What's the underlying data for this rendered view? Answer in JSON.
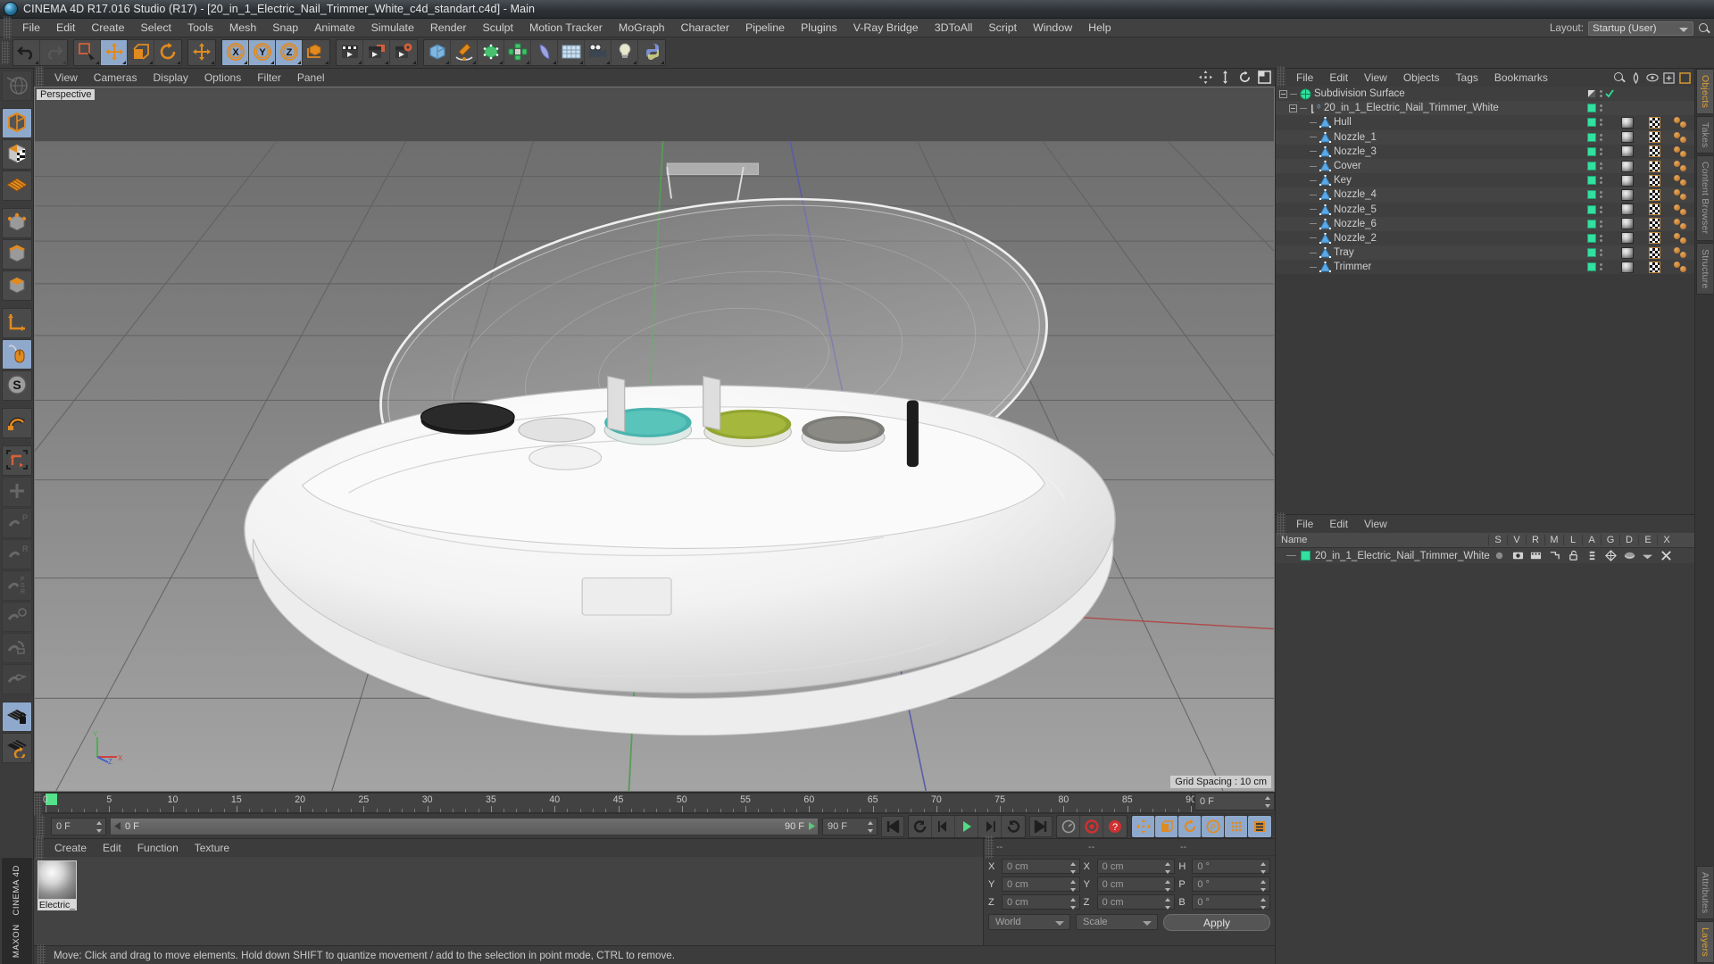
{
  "window": {
    "title": "CINEMA 4D R17.016 Studio (R17) - [20_in_1_Electric_Nail_Trimmer_White_c4d_standart.c4d] - Main",
    "logo_icon": "cinema4d-logo-icon"
  },
  "menubar": {
    "items": [
      "File",
      "Edit",
      "Create",
      "Select",
      "Tools",
      "Mesh",
      "Snap",
      "Animate",
      "Simulate",
      "Render",
      "Sculpt",
      "Motion Tracker",
      "MoGraph",
      "Character",
      "Pipeline",
      "Plugins",
      "V-Ray Bridge",
      "3DToAll",
      "Script",
      "Window",
      "Help"
    ],
    "layout_label": "Layout:",
    "layout_value": "Startup (User)",
    "search_icon": "search-icon"
  },
  "toolbar": {
    "groups": [
      {
        "buttons": [
          {
            "name": "undo-button",
            "icon": "undo-arrow-icon",
            "state": "normal"
          },
          {
            "name": "redo-button",
            "icon": "redo-arrow-icon",
            "state": "disabled"
          }
        ]
      },
      {
        "buttons": [
          {
            "name": "live-selection-button",
            "icon": "selection-cursor-icon",
            "state": "normal"
          },
          {
            "name": "move-tool-button",
            "icon": "move-arrows-icon",
            "state": "active"
          },
          {
            "name": "scale-tool-button",
            "icon": "scale-box-icon",
            "state": "normal"
          },
          {
            "name": "rotate-tool-button",
            "icon": "rotate-circle-icon",
            "state": "normal"
          }
        ]
      },
      {
        "buttons": [
          {
            "name": "move-duplicate-button",
            "icon": "move-arrows-icon",
            "state": "normal"
          }
        ]
      },
      {
        "buttons": [
          {
            "name": "lock-x-axis-button",
            "icon": "axis-x-icon",
            "state": "active"
          },
          {
            "name": "lock-y-axis-button",
            "icon": "axis-y-icon",
            "state": "active"
          },
          {
            "name": "lock-z-axis-button",
            "icon": "axis-z-icon",
            "state": "active"
          },
          {
            "name": "world-object-coords-button",
            "icon": "world-axis-cube-icon",
            "state": "normal"
          }
        ]
      },
      {
        "buttons": [
          {
            "name": "render-view-button",
            "icon": "clapperboard-icon",
            "state": "normal"
          },
          {
            "name": "render-region-button",
            "icon": "clapperboard-region-icon",
            "state": "normal"
          },
          {
            "name": "render-settings-button",
            "icon": "clapperboard-gear-icon",
            "state": "normal"
          }
        ]
      },
      {
        "buttons": [
          {
            "name": "add-cube-button",
            "icon": "cube-icon",
            "state": "normal"
          },
          {
            "name": "add-spline-button",
            "icon": "pen-spline-icon",
            "state": "normal"
          },
          {
            "name": "add-nurbs-button",
            "icon": "green-cube-nurbs-icon",
            "state": "normal"
          },
          {
            "name": "add-array-button",
            "icon": "mograph-cloner-icon",
            "state": "normal"
          },
          {
            "name": "add-deformer-button",
            "icon": "bend-deformer-icon",
            "state": "normal"
          },
          {
            "name": "add-scene-object-button",
            "icon": "floor-grid-icon",
            "state": "normal"
          },
          {
            "name": "add-camera-button",
            "icon": "camera-icon",
            "state": "normal"
          },
          {
            "name": "add-light-button",
            "icon": "lightbulb-icon",
            "state": "normal"
          },
          {
            "name": "python-button",
            "icon": "python-icon",
            "state": "normal"
          }
        ]
      }
    ]
  },
  "left_toolbar": {
    "buttons": [
      {
        "name": "undo-view-button",
        "icon": "globe-wire-icon",
        "state": "disabled"
      },
      {
        "name": "model-mode-button",
        "icon": "cube-orange-outline-icon",
        "state": "active"
      },
      {
        "name": "texture-mode-button",
        "icon": "checker-cube-icon",
        "state": "normal"
      },
      {
        "name": "uv-mesh-button",
        "icon": "orange-grid-icon",
        "state": "normal"
      },
      {
        "name": "point-mode-button",
        "icon": "point-cube-icon",
        "state": "normal"
      },
      {
        "name": "edge-mode-button",
        "icon": "edge-cube-icon",
        "state": "normal"
      },
      {
        "name": "polygon-mode-button",
        "icon": "polygon-cube-icon",
        "state": "normal"
      },
      {
        "name": "axis-mode-button",
        "icon": "orange-axis-icon",
        "state": "normal"
      },
      {
        "name": "viewport-solo-button",
        "icon": "mouse-icon",
        "state": "active"
      },
      {
        "name": "snap-mode-button",
        "icon": "s-compass-icon",
        "state": "normal"
      },
      {
        "name": "magnet-button",
        "icon": "magnet-icon",
        "state": "normal"
      },
      {
        "name": "workplane-button",
        "icon": "workplane-axis-icon",
        "state": "normal"
      },
      {
        "name": "enable-axis-button",
        "icon": "axis-plus-icon",
        "state": "disabled"
      },
      {
        "name": "lock-p-button",
        "icon": "lock-p-icon",
        "state": "disabled"
      },
      {
        "name": "lock-r-button",
        "icon": "lock-r-icon",
        "state": "disabled"
      },
      {
        "name": "lock-psr-button",
        "icon": "lock-psr-icon",
        "state": "disabled"
      },
      {
        "name": "lock-target-button",
        "icon": "lock-target-icon",
        "state": "disabled"
      },
      {
        "name": "lock-quantize-button",
        "icon": "lock-quantize-icon",
        "state": "disabled"
      },
      {
        "name": "lock-plane-button",
        "icon": "lock-plane-icon",
        "state": "disabled"
      },
      {
        "name": "workplane-lock-button",
        "icon": "grid-lock-icon",
        "state": "active"
      },
      {
        "name": "workplane-rotate-button",
        "icon": "grid-rotate-icon",
        "state": "normal"
      }
    ],
    "brand_line1": "MAXON",
    "brand_line2": "CINEMA 4D"
  },
  "viewport": {
    "menu": [
      "View",
      "Cameras",
      "Display",
      "Options",
      "Filter",
      "Panel"
    ],
    "label": "Perspective",
    "grid_spacing": "Grid Spacing : 10 cm",
    "corner_icons": [
      "move-view-icon",
      "pan-view-icon",
      "rotate-view-icon",
      "maximize-view-icon"
    ],
    "axis_labels": {
      "y": "Y",
      "x": "X",
      "z": "Z"
    }
  },
  "timeline": {
    "ticks": [
      0,
      5,
      10,
      15,
      20,
      25,
      30,
      35,
      40,
      45,
      50,
      55,
      60,
      65,
      70,
      75,
      80,
      85,
      90
    ],
    "range_start": 0,
    "range_end": 90,
    "current_frame_box": "0 F",
    "left_frame_field": "0 F",
    "bar_value": "0 F",
    "end_frame_small": "90 F",
    "end_frame_field": "90 F",
    "playback_buttons": [
      {
        "name": "go-to-start-button",
        "icon": "skip-start-icon"
      },
      {
        "name": "previous-keyframe-button",
        "icon": "prev-key-icon"
      },
      {
        "name": "step-back-button",
        "icon": "step-back-icon"
      },
      {
        "name": "play-button",
        "icon": "play-icon"
      },
      {
        "name": "step-forward-button",
        "icon": "step-forward-icon"
      },
      {
        "name": "next-keyframe-button",
        "icon": "next-key-icon"
      },
      {
        "name": "go-to-end-button",
        "icon": "skip-end-icon"
      }
    ],
    "record_buttons": [
      {
        "name": "autokey-button",
        "icon": "speedometer-icon"
      },
      {
        "name": "record-active-objects-button",
        "icon": "record-red-icon"
      },
      {
        "name": "keyframe-selection-button",
        "icon": "question-red-icon"
      }
    ],
    "key_toggles": [
      {
        "name": "position-key-button",
        "icon": "move-arrows-icon"
      },
      {
        "name": "scale-key-button",
        "icon": "scale-box-icon"
      },
      {
        "name": "rotation-key-button",
        "icon": "rotate-circle-icon"
      },
      {
        "name": "param-key-button",
        "icon": "param-p-icon"
      },
      {
        "name": "point-level-anim-button",
        "icon": "pla-dots-icon"
      },
      {
        "name": "timeline-toggle-button",
        "icon": "timeline-strip-icon"
      }
    ]
  },
  "material_manager": {
    "menu": [
      "Create",
      "Edit",
      "Function",
      "Texture"
    ],
    "materials": [
      {
        "name": "Electric_",
        "icon": "material-sphere-icon"
      }
    ]
  },
  "coordinates": {
    "header_cells": [
      "--",
      "--",
      "--"
    ],
    "position": {
      "label_x": "X",
      "label_y": "Y",
      "label_z": "Z",
      "x": "0 cm",
      "y": "0 cm",
      "z": "0 cm"
    },
    "size": {
      "label_x": "X",
      "label_y": "Y",
      "label_z": "Z",
      "x": "0 cm",
      "y": "0 cm",
      "z": "0 cm"
    },
    "rotation": {
      "label_h": "H",
      "label_p": "P",
      "label_b": "B",
      "h": "0 °",
      "p": "0 °",
      "b": "0 °"
    },
    "coord_system": "World",
    "size_mode": "Scale",
    "apply_label": "Apply"
  },
  "statusbar": {
    "message": "Move: Click and drag to move elements. Hold down SHIFT to quantize movement / add to the selection in point mode, CTRL to remove."
  },
  "object_manager": {
    "menu": [
      "File",
      "Edit",
      "View",
      "Objects",
      "Tags",
      "Bookmarks"
    ],
    "header_icons": [
      "search-icon",
      "filter-icon",
      "eye-icon",
      "new-layer-icon",
      "highlight-icon"
    ],
    "items": [
      {
        "label": "Subdivision Surface",
        "icon": "subdivision-surface-icon",
        "depth": 0,
        "expander": "minus",
        "enabled": "none",
        "check": true,
        "tags": []
      },
      {
        "label": "20_in_1_Electric_Nail_Trimmer_White",
        "icon": "null-object-icon",
        "depth": 1,
        "expander": "minus",
        "enabled": "green",
        "check": false,
        "tags": []
      },
      {
        "label": "Hull",
        "icon": "polygon-object-icon",
        "depth": 2,
        "expander": "none",
        "enabled": "green",
        "check": false,
        "tags": [
          "material",
          "texture",
          "uv"
        ]
      },
      {
        "label": "Nozzle_1",
        "icon": "polygon-object-icon",
        "depth": 2,
        "expander": "none",
        "enabled": "green",
        "check": false,
        "tags": [
          "material",
          "texture",
          "uv"
        ]
      },
      {
        "label": "Nozzle_3",
        "icon": "polygon-object-icon",
        "depth": 2,
        "expander": "none",
        "enabled": "green",
        "check": false,
        "tags": [
          "material",
          "texture",
          "uv"
        ]
      },
      {
        "label": "Cover",
        "icon": "polygon-object-icon",
        "depth": 2,
        "expander": "none",
        "enabled": "green",
        "check": false,
        "tags": [
          "material",
          "texture",
          "uv"
        ]
      },
      {
        "label": "Key",
        "icon": "polygon-object-icon",
        "depth": 2,
        "expander": "none",
        "enabled": "green",
        "check": false,
        "tags": [
          "material",
          "texture",
          "uv"
        ]
      },
      {
        "label": "Nozzle_4",
        "icon": "polygon-object-icon",
        "depth": 2,
        "expander": "none",
        "enabled": "green",
        "check": false,
        "tags": [
          "material",
          "texture",
          "uv"
        ]
      },
      {
        "label": "Nozzle_5",
        "icon": "polygon-object-icon",
        "depth": 2,
        "expander": "none",
        "enabled": "green",
        "check": false,
        "tags": [
          "material",
          "texture",
          "uv"
        ]
      },
      {
        "label": "Nozzle_6",
        "icon": "polygon-object-icon",
        "depth": 2,
        "expander": "none",
        "enabled": "green",
        "check": false,
        "tags": [
          "material",
          "texture",
          "uv"
        ]
      },
      {
        "label": "Nozzle_2",
        "icon": "polygon-object-icon",
        "depth": 2,
        "expander": "none",
        "enabled": "green",
        "check": false,
        "tags": [
          "material",
          "texture",
          "uv"
        ]
      },
      {
        "label": "Tray",
        "icon": "polygon-object-icon",
        "depth": 2,
        "expander": "none",
        "enabled": "green",
        "check": false,
        "tags": [
          "material",
          "texture",
          "uv"
        ]
      },
      {
        "label": "Trimmer",
        "icon": "polygon-object-icon",
        "depth": 2,
        "expander": "none",
        "enabled": "green",
        "check": false,
        "tags": [
          "material",
          "texture",
          "uv"
        ]
      }
    ]
  },
  "layer_manager": {
    "menu": [
      "File",
      "Edit",
      "View"
    ],
    "columns": [
      "Name",
      "S",
      "V",
      "R",
      "M",
      "L",
      "A",
      "G",
      "D",
      "E",
      "X"
    ],
    "rows": [
      {
        "label": "20_in_1_Electric_Nail_Trimmer_White",
        "color": "#32e0a0"
      }
    ]
  },
  "edge_tabs": {
    "top": [
      "Objects",
      "Takes",
      "Content Browser",
      "Structure"
    ],
    "bottom": [
      "Attributes",
      "Layers"
    ],
    "active_top": "Objects",
    "active_bottom": "Layers"
  },
  "colors": {
    "accent_orange": "#e0a030",
    "active_blue": "#8fa9cc",
    "enabled_green": "#32e0a0",
    "panel_bg": "#3c3c3c"
  }
}
